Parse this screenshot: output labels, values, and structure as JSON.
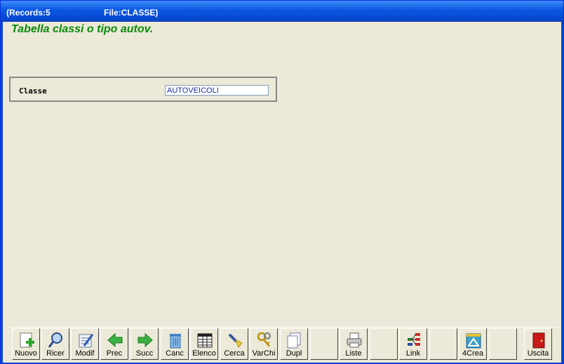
{
  "window": {
    "records_label": "(Records:5",
    "file_label": "File:CLASSE)"
  },
  "form": {
    "heading": "Tabella classi o tipo autov.",
    "field_label": "Classe",
    "field_value": "AUTOVEICOLI"
  },
  "toolbar": {
    "buttons": [
      {
        "label": "Nuovo",
        "icon": "new-document-icon"
      },
      {
        "label": "Ricer",
        "icon": "search-icon"
      },
      {
        "label": "Modif",
        "icon": "edit-icon"
      },
      {
        "label": "Prec",
        "icon": "arrow-left-icon"
      },
      {
        "label": "Succ",
        "icon": "arrow-right-icon"
      },
      {
        "label": "Canc",
        "icon": "trash-icon"
      },
      {
        "label": "Elenco",
        "icon": "table-icon"
      },
      {
        "label": "Cerca",
        "icon": "flashlight-icon"
      },
      {
        "label": "VarChi",
        "icon": "keys-icon"
      },
      {
        "label": "Dupl",
        "icon": "duplicate-icon"
      },
      {
        "label": "",
        "icon": ""
      },
      {
        "label": "Liste",
        "icon": "printer-icon"
      },
      {
        "label": "",
        "icon": ""
      },
      {
        "label": "Link",
        "icon": "network-icon"
      },
      {
        "label": "",
        "icon": ""
      },
      {
        "label": "4Crea",
        "icon": "design-icon"
      },
      {
        "label": "",
        "icon": ""
      },
      {
        "label": "Uscita",
        "icon": "exit-door-icon"
      }
    ]
  },
  "colors": {
    "heading": "#0a8a0a",
    "titlebar": "#0a57e3",
    "background": "#ece9d8"
  }
}
